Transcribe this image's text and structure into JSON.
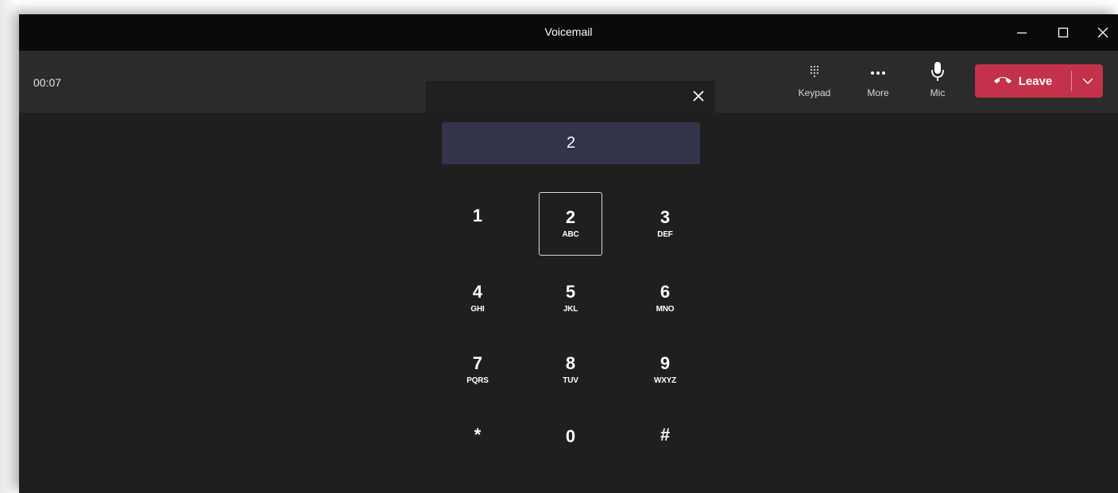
{
  "window": {
    "title": "Voicemail"
  },
  "call": {
    "timer": "00:07"
  },
  "toolbar": {
    "keypad_label": "Keypad",
    "more_label": "More",
    "mic_label": "Mic",
    "leave_label": "Leave"
  },
  "dialpad": {
    "display_value": "2",
    "keys": [
      {
        "digit": "1",
        "letters": ""
      },
      {
        "digit": "2",
        "letters": "ABC"
      },
      {
        "digit": "3",
        "letters": "DEF"
      },
      {
        "digit": "4",
        "letters": "GHI"
      },
      {
        "digit": "5",
        "letters": "JKL"
      },
      {
        "digit": "6",
        "letters": "MNO"
      },
      {
        "digit": "7",
        "letters": "PQRS"
      },
      {
        "digit": "8",
        "letters": "TUV"
      },
      {
        "digit": "9",
        "letters": "WXYZ"
      },
      {
        "digit": "*",
        "letters": ""
      },
      {
        "digit": "0",
        "letters": ""
      },
      {
        "digit": "#",
        "letters": ""
      }
    ]
  },
  "icons": {
    "keypad": "keypad-icon",
    "more": "more-icon",
    "mic": "mic-icon",
    "leave": "phone-hangup-icon",
    "leave_options": "chevron-down-icon",
    "close": "close-icon",
    "minimize": "minimize-icon",
    "maximize": "maximize-icon"
  },
  "colors": {
    "leave_button": "#c4314b",
    "display_background": "#33344a",
    "window_background": "#1f1f1f",
    "titlebar_background": "#0a0a0a",
    "toolbar_background": "#2b2b2b"
  }
}
